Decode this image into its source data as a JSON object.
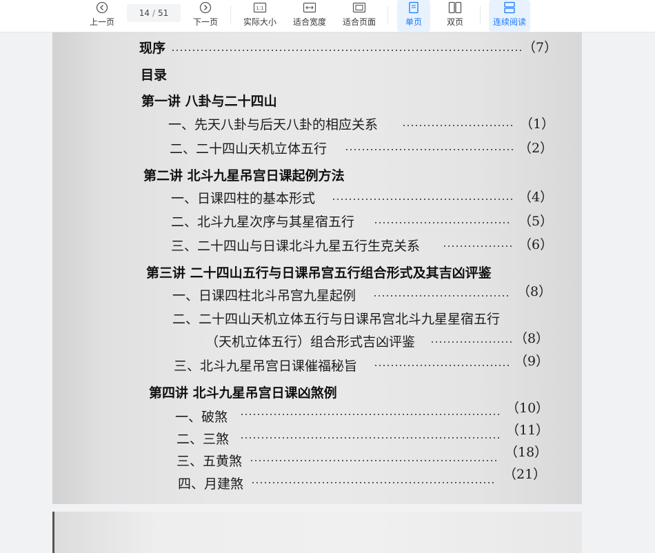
{
  "toolbar": {
    "prev_label": "上一页",
    "current_page": "14",
    "total_pages": "51",
    "page_sep": "/",
    "next_label": "下一页",
    "actual_size_label": "实际大小",
    "fit_width_label": "适合宽度",
    "fit_page_label": "适合页面",
    "single_page_label": "单页",
    "double_page_label": "双页",
    "continuous_label": "连续阅读",
    "accent_color": "#1677ff"
  },
  "document": {
    "toc": [
      {
        "kind": "entry",
        "text": "现序",
        "page": "（7）",
        "bold": true
      },
      {
        "kind": "heading",
        "text": "目录"
      },
      {
        "kind": "heading",
        "text": "第一讲  八卦与二十四山"
      },
      {
        "kind": "entry",
        "text": "一、先天八卦与后天八卦的相应关系",
        "page": "（1）"
      },
      {
        "kind": "entry",
        "text": "二、二十四山天机立体五行",
        "page": "（2）"
      },
      {
        "kind": "heading",
        "text": "第二讲  北斗九星吊宫日课起例方法"
      },
      {
        "kind": "entry",
        "text": "一、日课四柱的基本形式",
        "page": "（4）"
      },
      {
        "kind": "entry",
        "text": "二、北斗九星次序与其星宿五行",
        "page": "（5）"
      },
      {
        "kind": "entry",
        "text": "三、二十四山与日课北斗九星五行生克关系",
        "page": "（6）"
      },
      {
        "kind": "heading",
        "text": "第三讲  二十四山五行与日课吊宫五行组合形式及其吉凶评鉴"
      },
      {
        "kind": "entry",
        "text": "一、日课四柱北斗吊宫九星起例",
        "page": "（8）"
      },
      {
        "kind": "entry",
        "text": "二、二十四山天机立体五行与日课吊宫北斗九星星宿五行",
        "page": ""
      },
      {
        "kind": "entry",
        "text": "（天机立体五行）组合形式吉凶评鉴",
        "page": "（8）"
      },
      {
        "kind": "entry",
        "text": "三、北斗九星吊宫日课催福秘旨",
        "page": "（9）"
      },
      {
        "kind": "heading",
        "text": "第四讲  北斗九星吊宫日课凶煞例"
      },
      {
        "kind": "entry",
        "text": "一、破煞",
        "page": "（10）"
      },
      {
        "kind": "entry",
        "text": "二、三煞",
        "page": "（11）"
      },
      {
        "kind": "entry",
        "text": "三、五黄煞",
        "page": "（18）"
      },
      {
        "kind": "entry",
        "text": "四、月建煞",
        "page": "（21）"
      }
    ]
  }
}
